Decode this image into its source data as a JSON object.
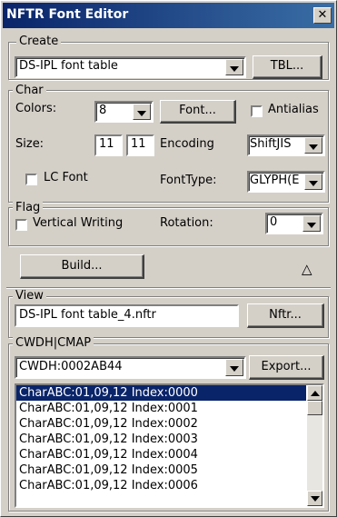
{
  "window": {
    "title": "NFTR Font Editor",
    "close_symbol": "✕"
  },
  "create": {
    "legend": "Create",
    "table_value": "DS-IPL font table",
    "tbl_button": "TBL..."
  },
  "char": {
    "legend": "Char",
    "colors_label": "Colors:",
    "colors_value": "8",
    "font_button": "Font...",
    "antialias_label": "Antialias",
    "size_label": "Size:",
    "size_w": "11",
    "size_h": "11",
    "encoding_label": "Encoding",
    "encoding_value": "ShiftJIS",
    "lc_font_label": "LC Font",
    "fonttype_label": "FontType:",
    "fonttype_value": "GLYPH(E"
  },
  "flag": {
    "legend": "Flag",
    "vertical_label": "Vertical Writing",
    "rotation_label": "Rotation:",
    "rotation_value": "0"
  },
  "build": {
    "button": "Build...",
    "collapse_symbol": "△"
  },
  "view": {
    "legend": "View",
    "file_value": "DS-IPL font table_4.nftr",
    "nftr_button": "Nftr..."
  },
  "cwdh": {
    "legend": "CWDH|CMAP",
    "combo_value": "CWDH:0002AB44",
    "export_button": "Export...",
    "items": [
      "CharABC:01,09,12 Index:0000",
      "CharABC:01,09,12 Index:0001",
      "CharABC:01,09,12 Index:0002",
      "CharABC:01,09,12 Index:0003",
      "CharABC:01,09,12 Index:0004",
      "CharABC:01,09,12 Index:0005",
      "CharABC:01,09,12 Index:0006"
    ],
    "selected_index": 0
  }
}
